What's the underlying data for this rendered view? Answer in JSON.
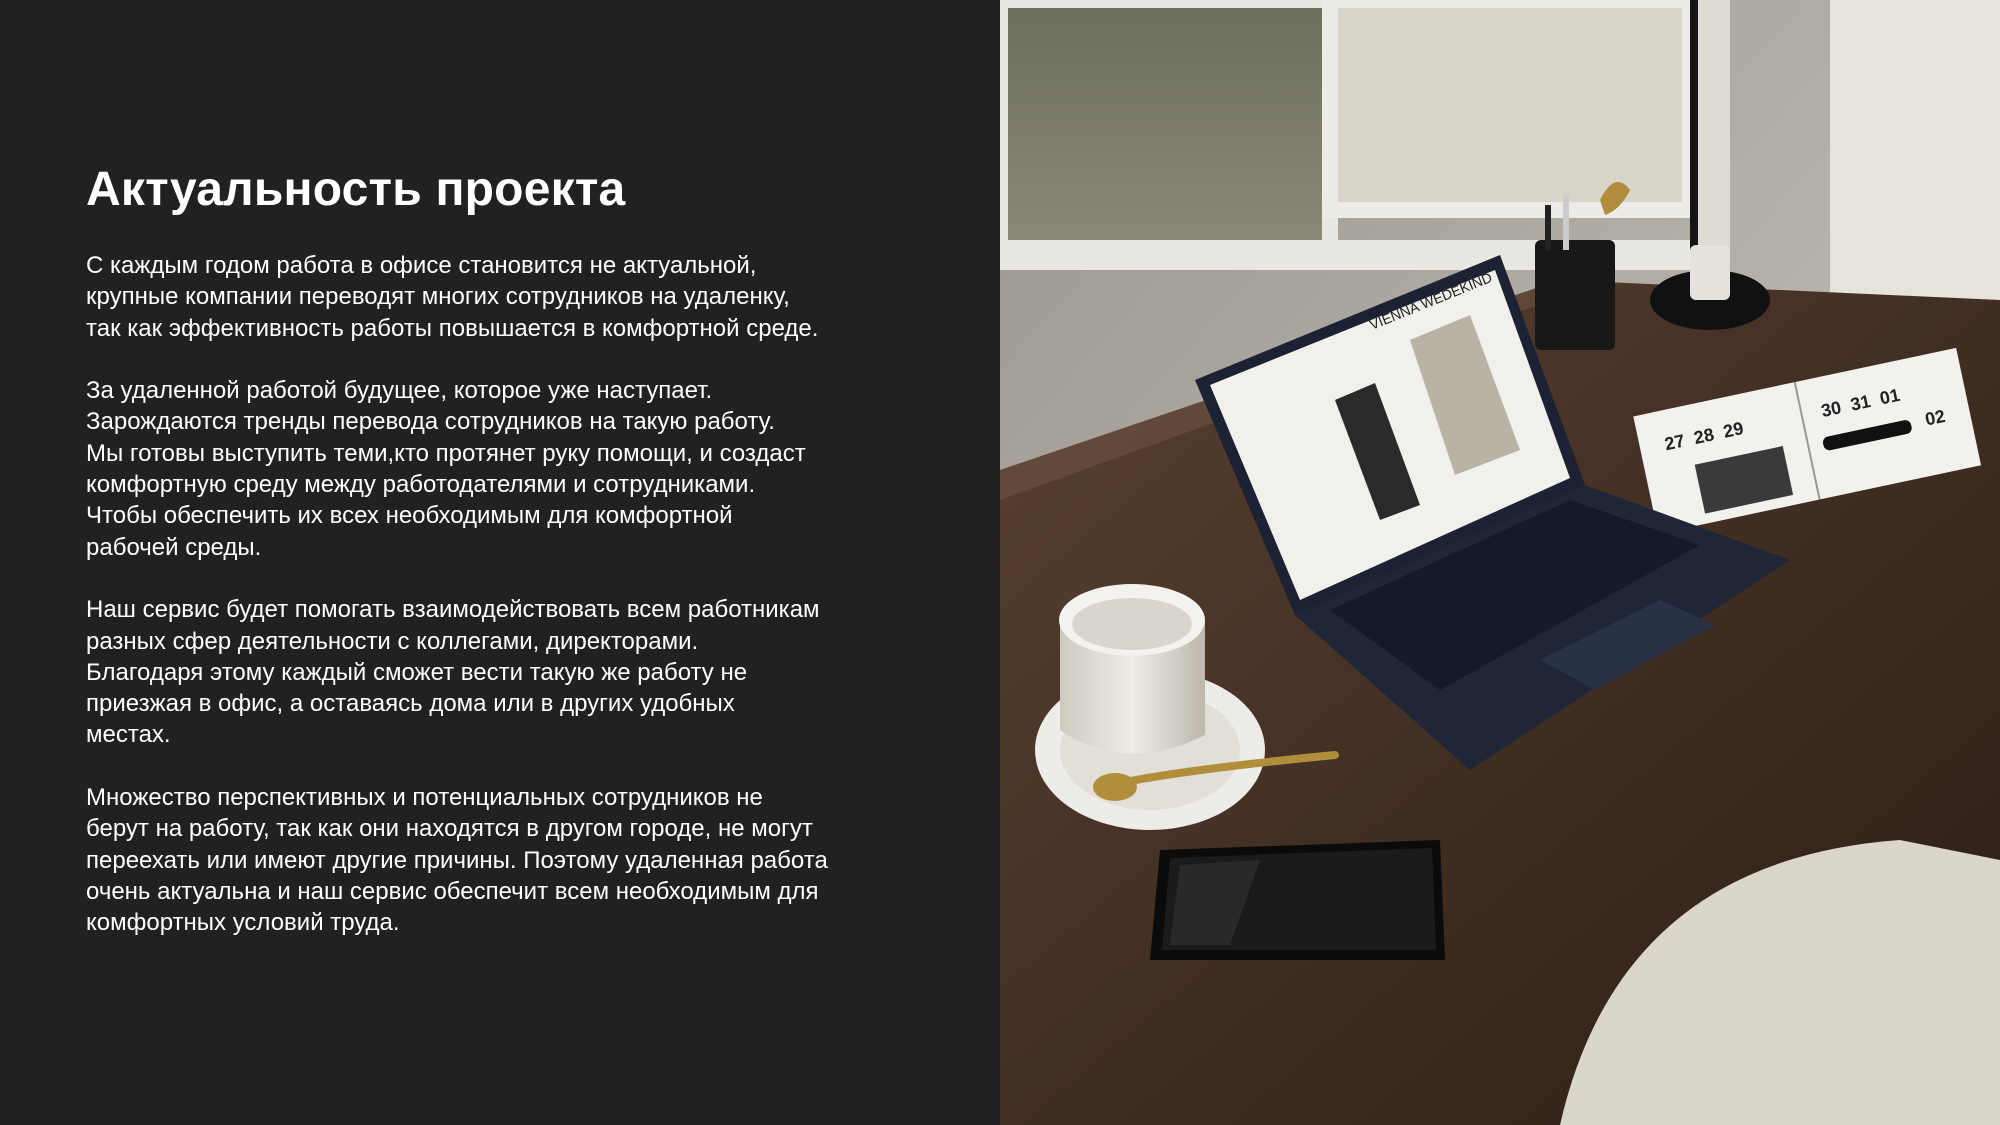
{
  "slide": {
    "title": "Актуальность проекта",
    "paragraphs": [
      "С каждым годом работа в офисе становится не актуальной,\nкрупные компании переводят многих сотрудников на удаленку,\nтак как эффективность работы повышается в комфортной среде.",
      "За удаленной работой будущее, которое уже наступает.\nЗарождаются тренды перевода сотрудников на такую работу.\nМы готовы выступить теми,кто протянет руку помощи, и создаст\nкомфортную среду между работодателями и сотрудниками.\nЧтобы обеспечить их всех необходимым для комфортной\nрабочей среды.",
      "Наш сервис будет помогать взаимодействовать всем работникам\nразных сфер деятельности с коллегами, директорами.\nБлагодаря этому каждый сможет вести такую же работу не\nприезжая в офис, а оставаясь дома или в других удобных\nместах.",
      "Множество перспективных и потенциальных сотрудников не\nберут на работу, так как они находятся в другом городе, не могут\nпереехать или имеют другие причины. Поэтому удаленная работа\nочень актуальна и наш сервис обеспечит всем необходимым для\nкомфортных условий труда."
    ]
  },
  "photo": {
    "screen_brand": "VIENNA WEDEKIND",
    "calendar_numbers": [
      "27",
      "28",
      "29",
      "30",
      "31",
      "01",
      "02"
    ]
  },
  "colors": {
    "background": "#212121",
    "text": "#ffffff"
  }
}
